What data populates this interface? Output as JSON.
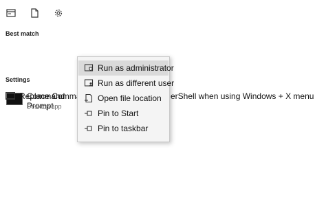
{
  "toolbar": {
    "icons": [
      "app-icon",
      "document-icon",
      "gear-icon"
    ]
  },
  "best_match": {
    "heading": "Best match",
    "title": "Command Prompt",
    "subtitle": "Desktop app"
  },
  "settings": {
    "heading": "Settings",
    "item_left": "Replace Command",
    "item_right": "erShell when using Windows + X menu"
  },
  "context_menu": {
    "items": [
      {
        "label": "Run as administrator",
        "icon": "shield-icon"
      },
      {
        "label": "Run as different user",
        "icon": "user-icon"
      },
      {
        "label": "Open file location",
        "icon": "file-location-icon"
      },
      {
        "label": "Pin to Start",
        "icon": "pin-icon"
      },
      {
        "label": "Pin to taskbar",
        "icon": "pin-taskbar-icon"
      }
    ]
  }
}
